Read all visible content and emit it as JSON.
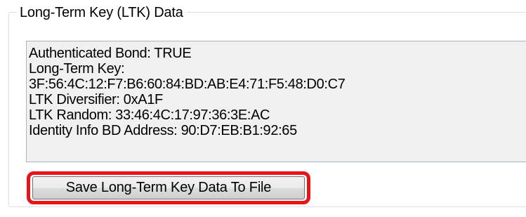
{
  "groupbox": {
    "title": "Long-Term Key (LTK) Data"
  },
  "ltk_data": {
    "lines": [
      "Authenticated Bond: TRUE",
      "Long-Term Key:",
      "3F:56:4C:12:F7:B6:60:84:BD:AB:E4:71:F5:48:D0:C7",
      "LTK Diversifier: 0xA1F",
      "LTK Random: 33:46:4C:17:97:36:3E:AC",
      "Identity Info BD Address: 90:D7:EB:B1:92:65"
    ]
  },
  "save_button": {
    "label": "Save Long-Term Key Data To File"
  },
  "colors": {
    "highlight": "#e8141a",
    "text_area_background": "#f0f0f0"
  }
}
